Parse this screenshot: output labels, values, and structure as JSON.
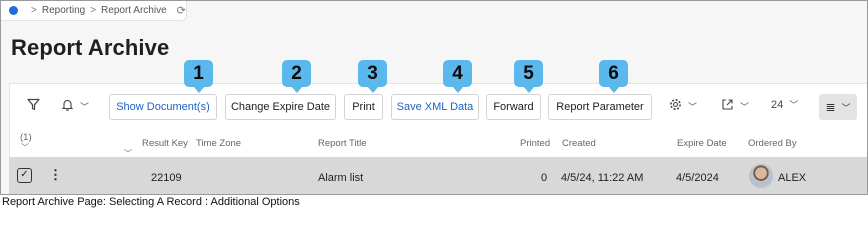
{
  "breadcrumb": {
    "items": [
      "Reporting",
      "Report Archive"
    ],
    "separator": ">"
  },
  "page": {
    "title": "Report Archive"
  },
  "toolbar": {
    "buttons": [
      {
        "label": "Show Document(s)",
        "badge": "1",
        "color": "blue"
      },
      {
        "label": "Change Expire Date",
        "badge": "2",
        "color": "dark"
      },
      {
        "label": "Print",
        "badge": "3",
        "color": "dark"
      },
      {
        "label": "Save XML Data",
        "badge": "4",
        "color": "blue"
      },
      {
        "label": "Forward",
        "badge": "5",
        "color": "dark"
      },
      {
        "label": "Report Parameter",
        "badge": "6",
        "color": "dark"
      }
    ],
    "page_size": "24",
    "icons": [
      "filter-icon",
      "bell-icon",
      "gear-icon",
      "export-icon",
      "list-view-icon"
    ]
  },
  "table": {
    "selected_count": "(1)",
    "columns": [
      "Result Key",
      "Time Zone",
      "Report Title",
      "Printed",
      "Created",
      "Expire Date",
      "Ordered By"
    ],
    "rows": [
      {
        "result_key": "22109",
        "time_zone": "",
        "report_title": "Alarm list",
        "printed": "0",
        "created": "4/5/24, 11:22 AM",
        "expire_date": "4/5/2024",
        "ordered_by": "ALEX",
        "selected": true
      }
    ]
  },
  "caption": "Report Archive Page: Selecting A Record : Additional Options",
  "colors": {
    "accent": "#1c62c4",
    "badge": "#5ab8ec",
    "selected_row": "#d8d8d8"
  }
}
